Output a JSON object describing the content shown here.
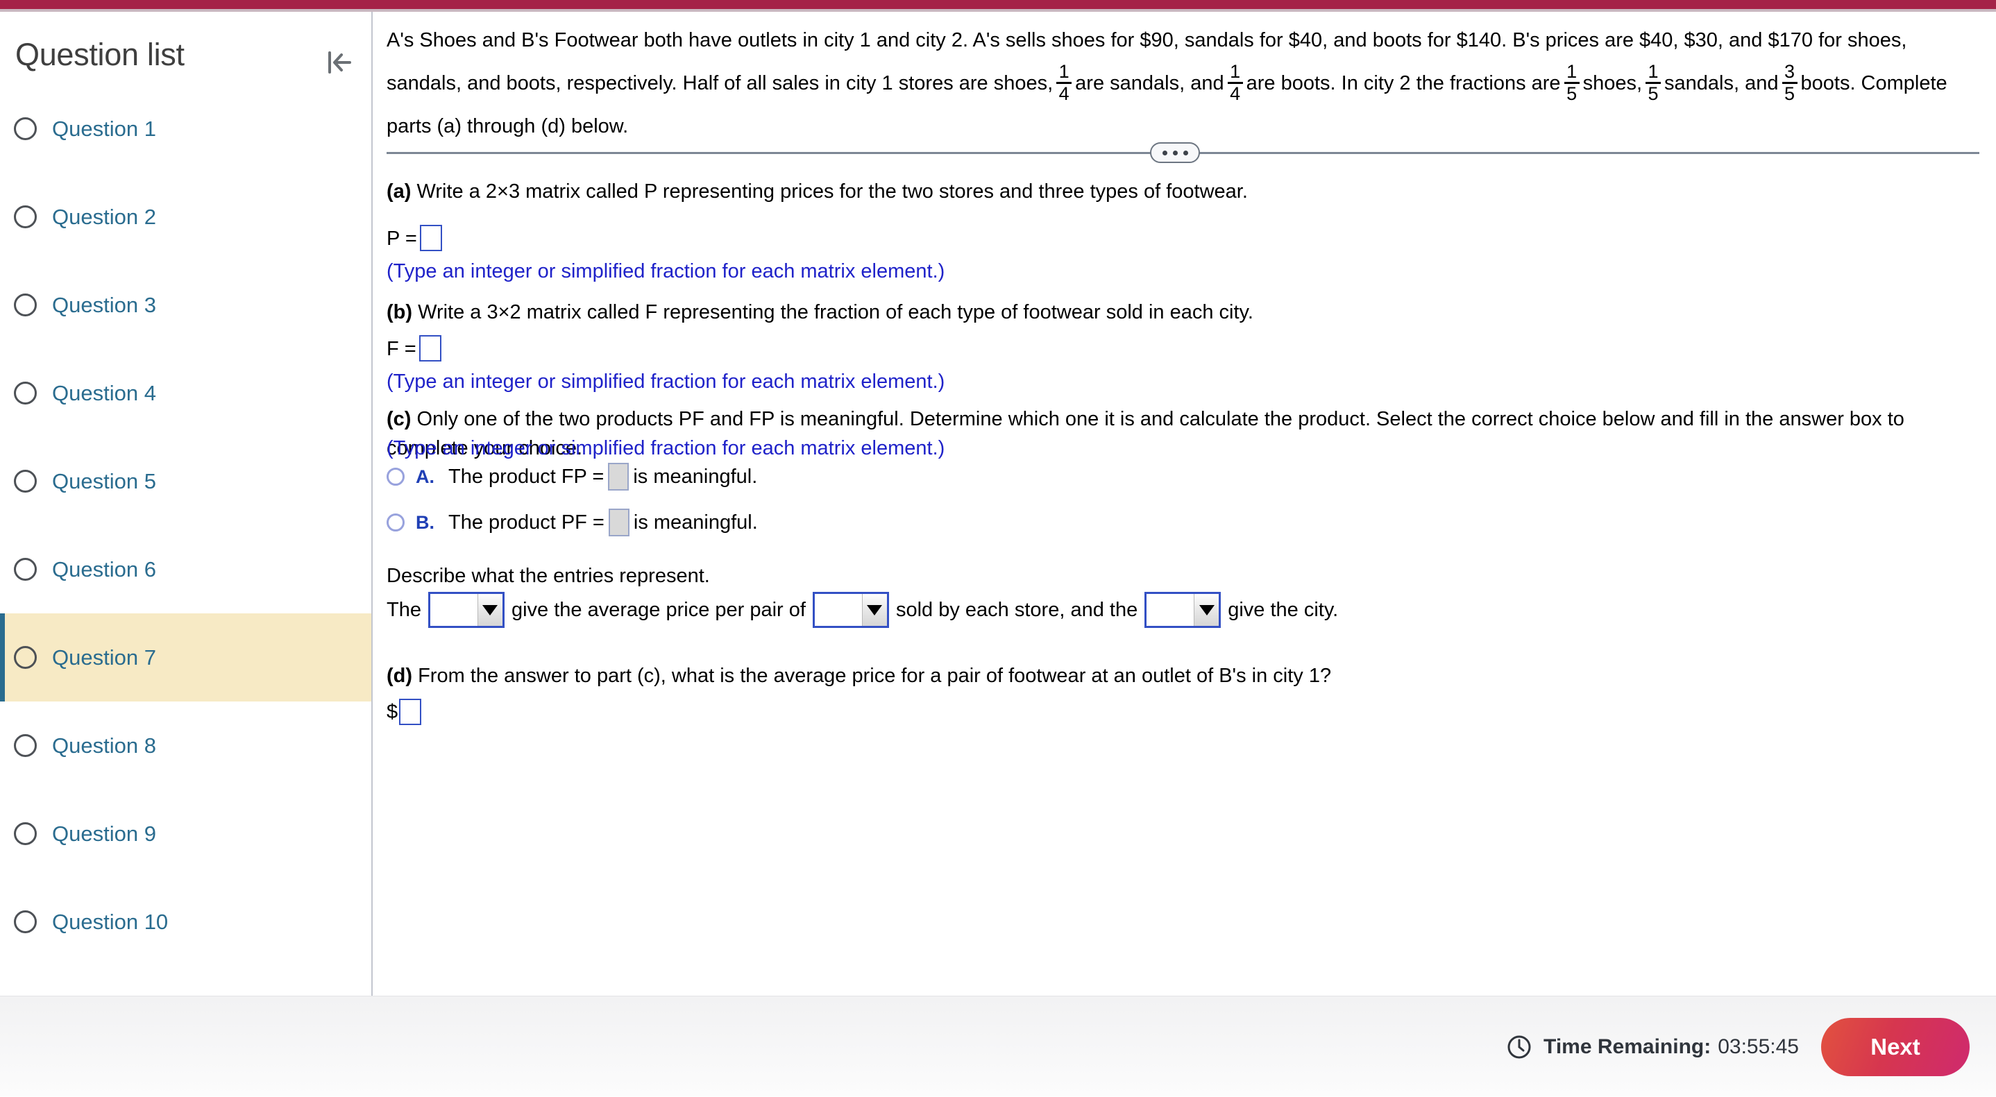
{
  "theme": {
    "accent_bar": "#a52248",
    "link_blue": "#2a6c8f",
    "hint_blue": "#1f22c9",
    "active_row_bg": "#f7eac5",
    "next_gradient_start": "#e2523f",
    "next_gradient_end": "#cf2a6e"
  },
  "sidebar": {
    "title": "Question list",
    "collapse_icon": "collapse-left-icon",
    "items": [
      {
        "label": "Question 1",
        "active": false
      },
      {
        "label": "Question 2",
        "active": false
      },
      {
        "label": "Question 3",
        "active": false
      },
      {
        "label": "Question 4",
        "active": false
      },
      {
        "label": "Question 5",
        "active": false
      },
      {
        "label": "Question 6",
        "active": false
      },
      {
        "label": "Question 7",
        "active": true
      },
      {
        "label": "Question 8",
        "active": false
      },
      {
        "label": "Question 9",
        "active": false
      },
      {
        "label": "Question 10",
        "active": false
      }
    ]
  },
  "question": {
    "stem": {
      "p1": "A's Shoes and B's Footwear both have outlets in city 1 and city 2. A's sells shoes for $90, sandals for $40, and boots for $140. B's prices are $40, $30, and $170 for shoes, sandals, and boots,",
      "p2_a": "respectively. Half of all sales in city 1 stores are shoes,",
      "frac1": {
        "num": "1",
        "den": "4"
      },
      "p2_b": "are sandals, and",
      "frac2": {
        "num": "1",
        "den": "4"
      },
      "p2_c": "are boots. In city 2 the fractions are",
      "frac3": {
        "num": "1",
        "den": "5"
      },
      "p2_d": "shoes,",
      "frac4": {
        "num": "1",
        "den": "5"
      },
      "p2_e": "sandals, and",
      "frac5": {
        "num": "3",
        "den": "5"
      },
      "p2_f": "boots. Complete parts (a) through (d) below."
    },
    "ellipsis_label": "more-options",
    "part_a": {
      "marker": "(a)",
      "text": "Write a 2×3 matrix called P representing prices for the two stores and three types of footwear.",
      "matrix_label": "P =",
      "answer_value": "",
      "hint": "(Type an integer or simplified fraction for each matrix element.)"
    },
    "part_b": {
      "marker": "(b)",
      "text": "Write a 3×2 matrix called F representing the fraction of each type of footwear sold in each city.",
      "matrix_label": "F =",
      "answer_value": "",
      "hint": "(Type an integer or simplified fraction for each matrix element.)"
    },
    "part_c": {
      "marker": "(c)",
      "text": "Only one of the two products PF and FP is meaningful. Determine which one it is and calculate the product. Select the correct choice below and fill in the answer box to complete your choice.",
      "hint": "(Type an integer or simplified fraction for each matrix element.)",
      "choices": [
        {
          "letter": "A.",
          "before": "The product FP =",
          "after": "is meaningful.",
          "value": "",
          "selected": false
        },
        {
          "letter": "B.",
          "before": "The product PF =",
          "after": "is meaningful.",
          "value": "",
          "selected": false
        }
      ],
      "describe_prompt": "Describe what the entries represent.",
      "sentence": {
        "s1": "The",
        "s2": "give the average price per pair of",
        "s3": "sold by each store, and the",
        "s4": "give the city.",
        "dropdown1_value": "",
        "dropdown2_value": "",
        "dropdown3_value": ""
      }
    },
    "part_d": {
      "marker": "(d)",
      "text": "From the answer to part (c), what is the average price for a pair of footwear at an outlet of B's in city 1?",
      "currency": "$",
      "answer_value": ""
    }
  },
  "footer": {
    "clock_icon": "clock-icon",
    "time_label": "Time Remaining:",
    "time_value": "03:55:45",
    "next_label": "Next"
  }
}
